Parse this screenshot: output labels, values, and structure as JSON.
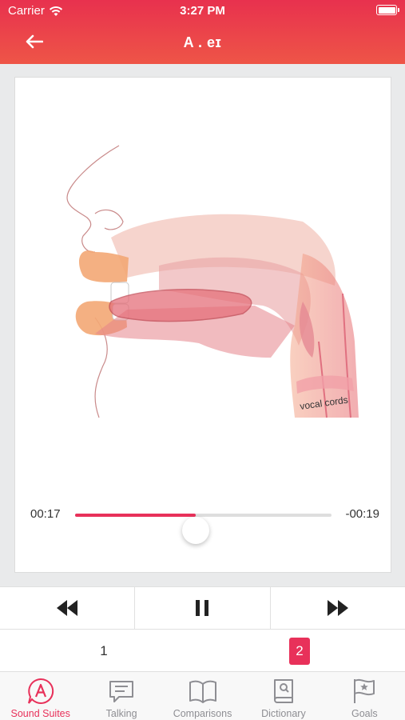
{
  "status": {
    "carrier": "Carrier",
    "time": "3:27 PM"
  },
  "nav": {
    "title": "A . eɪ",
    "back_icon": "arrow-left-icon"
  },
  "illustration": {
    "label": "vocal cords"
  },
  "player": {
    "elapsed": "00:17",
    "remaining": "-00:19",
    "progress": 0.47
  },
  "controls": {
    "rewind_icon": "rewind-icon",
    "pause_icon": "pause-icon",
    "forward_icon": "fast-forward-icon"
  },
  "pages": {
    "items": [
      "1",
      "2"
    ],
    "selected": "2"
  },
  "tabs": [
    {
      "label": "Sound Suites",
      "icon": "sound-suites-icon",
      "active": true
    },
    {
      "label": "Talking",
      "icon": "chat-icon",
      "active": false
    },
    {
      "label": "Comparisons",
      "icon": "book-icon",
      "active": false
    },
    {
      "label": "Dictionary",
      "icon": "dictionary-icon",
      "active": false
    },
    {
      "label": "Goals",
      "icon": "flag-icon",
      "active": false
    }
  ],
  "colors": {
    "accent": "#e8315a",
    "header_top": "#e8314e",
    "header_bottom": "#ee5547",
    "tab_inactive": "#8e8e93"
  }
}
